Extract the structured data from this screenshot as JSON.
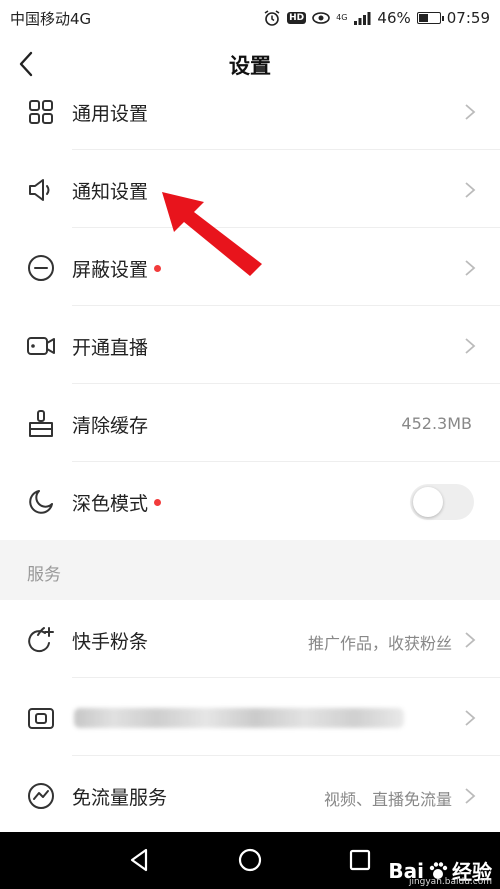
{
  "status_bar": {
    "carrier": "中国移动4G",
    "network_badge": "4G",
    "hd_badge": "HD",
    "battery": "46%",
    "battery_level": 0.46,
    "time": "07:59"
  },
  "header": {
    "title": "设置"
  },
  "settings": {
    "general": {
      "label": "通用设置",
      "icon": "grid-icon"
    },
    "notification": {
      "label": "通知设置",
      "icon": "speaker-icon"
    },
    "block": {
      "label": "屏蔽设置",
      "icon": "minus-circle-icon",
      "has_dot": true
    },
    "live": {
      "label": "开通直播",
      "icon": "video-camera-icon"
    },
    "cache": {
      "label": "清除缓存",
      "icon": "broom-icon",
      "value": "452.3MB"
    },
    "dark_mode": {
      "label": "深色模式",
      "icon": "moon-icon",
      "has_dot": true,
      "enabled": false
    }
  },
  "services": {
    "section_title": "服务",
    "fans": {
      "label": "快手粉条",
      "icon": "rocket-plus-icon",
      "value": "推广作品，收获粉丝"
    },
    "wallet": {
      "label": "",
      "icon": "wallet-icon"
    },
    "free_data": {
      "label": "免流量服务",
      "icon": "trend-circle-icon",
      "value": "视频、直播免流量"
    }
  },
  "watermark": {
    "logo": "Bai",
    "brand": "经验",
    "url": "jingyan.baidu.com"
  },
  "colors": {
    "accent_red": "#f23b3b",
    "annotation_arrow": "#e8141c",
    "section_bg": "#f4f4f4"
  }
}
